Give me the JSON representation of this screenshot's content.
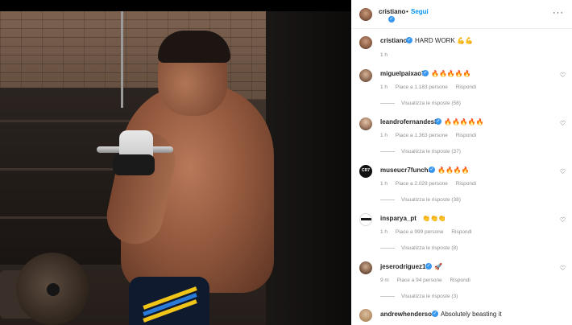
{
  "post": {
    "username": "cristiano",
    "follow_label": "Segui",
    "separator": "•",
    "more_label": "···",
    "caption": "HARD WORK 💪💪",
    "caption_time": "1 h"
  },
  "comments": [
    {
      "username": "miguelpaixao7",
      "text": "🔥🔥🔥🔥🔥",
      "time": "1 h",
      "likes": "Piace a 1.183 persone",
      "reply": "Rispondi",
      "view_replies": "Visualizza le risposte (58)"
    },
    {
      "username": "leandrofernandes8",
      "text": "🔥🔥🔥🔥🔥",
      "time": "1 h",
      "likes": "Piace a 1.363 persone",
      "reply": "Rispondi",
      "view_replies": "Visualizza le risposte (37)"
    },
    {
      "username": "museucr7funchal",
      "text": "🔥🔥🔥🔥",
      "time": "1 h",
      "likes": "Piace a 2.029 persone",
      "reply": "Rispondi",
      "view_replies": "Visualizza le risposte (38)"
    },
    {
      "username": "insparya_pt",
      "text": "👏👏👏",
      "time": "1 h",
      "likes": "Piace a 999 persone",
      "reply": "Rispondi",
      "view_replies": "Visualizza le risposte (8)"
    },
    {
      "username": "jeserodriguez10",
      "text": "🚀",
      "time": "9 m",
      "likes": "Piace a 94 persone",
      "reply": "Rispondi",
      "view_replies": "Visualizza le risposte (3)"
    },
    {
      "username": "andrewhenderson",
      "text": "Absolutely beasting it"
    }
  ],
  "avatars": {
    "museucr7funchal": "CR7",
    "insparya_pt": "insparya"
  },
  "icons": {
    "verified": "✓",
    "heart": "♡"
  }
}
